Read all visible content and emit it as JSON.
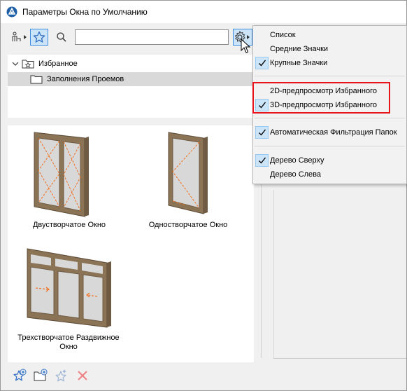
{
  "window": {
    "title": "Параметры Окна по Умолчанию",
    "title_icon": "archicad-logo-icon"
  },
  "toolbar": {
    "search": {
      "value": "",
      "placeholder": ""
    }
  },
  "tree": {
    "root": {
      "label": "Избранное"
    },
    "child": {
      "label": "Заполнения Проемов"
    }
  },
  "favorites": {
    "items": [
      {
        "label": "Двустворчатое Окно"
      },
      {
        "label": "Одностворчатое Окно"
      },
      {
        "label": "Трехстворчатое Раздвижное Окно"
      }
    ]
  },
  "menu": {
    "items": [
      {
        "label": "Список",
        "checked": false
      },
      {
        "label": "Средние Значки",
        "checked": false
      },
      {
        "label": "Крупные Значки",
        "checked": true
      },
      {
        "label": "2D-предпросмотр Избранного",
        "checked": false
      },
      {
        "label": "3D-предпросмотр Избранного",
        "checked": true
      },
      {
        "label": "Автоматическая Фильтрация Папок",
        "checked": true
      },
      {
        "label": "Дерево Сверху",
        "checked": true
      },
      {
        "label": "Дерево Слева",
        "checked": false
      }
    ]
  },
  "colors": {
    "accent_blue": "#2f6fc4",
    "highlight_red": "#e8141c",
    "frame_wood": "#8b7355",
    "opening_line": "#f07020",
    "delete_red": "#f08080"
  }
}
